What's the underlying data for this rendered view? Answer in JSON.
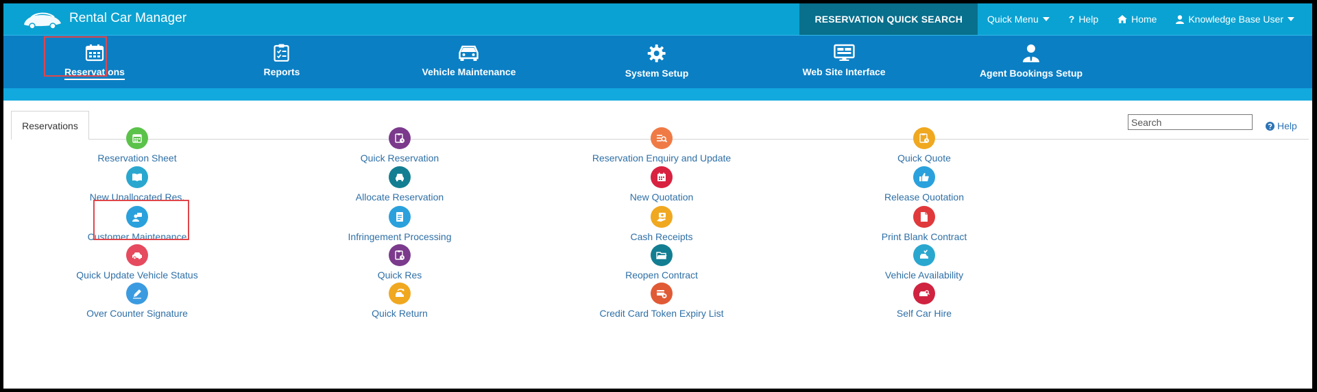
{
  "app": {
    "title": "Rental Car Manager"
  },
  "topnav": {
    "quick_search": "RESERVATION QUICK SEARCH",
    "quick_menu": "Quick Menu",
    "help": "Help",
    "home": "Home",
    "user": "Knowledge Base User"
  },
  "mainnav": {
    "items": [
      {
        "label": "Reservations"
      },
      {
        "label": "Reports"
      },
      {
        "label": "Vehicle Maintenance"
      },
      {
        "label": "System Setup"
      },
      {
        "label": "Web Site Interface"
      },
      {
        "label": "Agent Bookings Setup"
      }
    ],
    "active": "Reservations"
  },
  "content": {
    "tab": "Reservations",
    "search_placeholder": "Search",
    "help": "Help",
    "columns": [
      [
        {
          "label": "Reservation Sheet",
          "icon": "calendar-grid-icon",
          "color": "#5bc24a"
        },
        {
          "label": "New Unallocated Res.",
          "icon": "book-open-icon",
          "color": "#2aa7cf"
        },
        {
          "label": "Customer Maintenance",
          "icon": "user-card-icon",
          "color": "#2aa1dc"
        },
        {
          "label": "Quick Update Vehicle Status",
          "icon": "car-icon",
          "color": "#e64a5e"
        },
        {
          "label": "Over Counter Signature",
          "icon": "pen-icon",
          "color": "#3b9be0"
        }
      ],
      [
        {
          "label": "Quick Reservation",
          "icon": "clipboard-clock-icon",
          "color": "#7b3a8c"
        },
        {
          "label": "Allocate Reservation",
          "icon": "car-front-icon",
          "color": "#137e92"
        },
        {
          "label": "Infringement Processing",
          "icon": "document-icon",
          "color": "#2aa1dc"
        },
        {
          "label": "Quick Res",
          "icon": "clipboard-clock-icon",
          "color": "#7b3a8c"
        },
        {
          "label": "Quick Return",
          "icon": "car-return-icon",
          "color": "#f0a820"
        }
      ],
      [
        {
          "label": "Reservation Enquiry and Update",
          "icon": "list-search-icon",
          "color": "#f07a45"
        },
        {
          "label": "New Quotation",
          "icon": "calendar-icon",
          "color": "#d8223f"
        },
        {
          "label": "Cash Receipts",
          "icon": "cash-hand-icon",
          "color": "#f0a820"
        },
        {
          "label": "Reopen Contract",
          "icon": "folder-open-icon",
          "color": "#137e92"
        },
        {
          "label": "Credit Card Token Expiry List",
          "icon": "card-x-icon",
          "color": "#e05a35"
        }
      ],
      [
        {
          "label": "Quick Quote",
          "icon": "clipboard-clock-icon",
          "color": "#f0a820"
        },
        {
          "label": "Release Quotation",
          "icon": "thumbs-up-icon",
          "color": "#2aa1dc"
        },
        {
          "label": "Print Blank Contract",
          "icon": "page-icon",
          "color": "#e0393c"
        },
        {
          "label": "Vehicle Availability",
          "icon": "car-check-icon",
          "color": "#2aa7cf"
        },
        {
          "label": "Self Car Hire",
          "icon": "car-key-icon",
          "color": "#cf2340"
        }
      ]
    ]
  },
  "colors": {
    "topbar": "#0aa2d2",
    "quick_search_bg": "#086f8c",
    "mainnav": "#0b7fc4",
    "strip": "#12a9df",
    "link": "#2e6fa6",
    "highlight": "#e0464b"
  }
}
